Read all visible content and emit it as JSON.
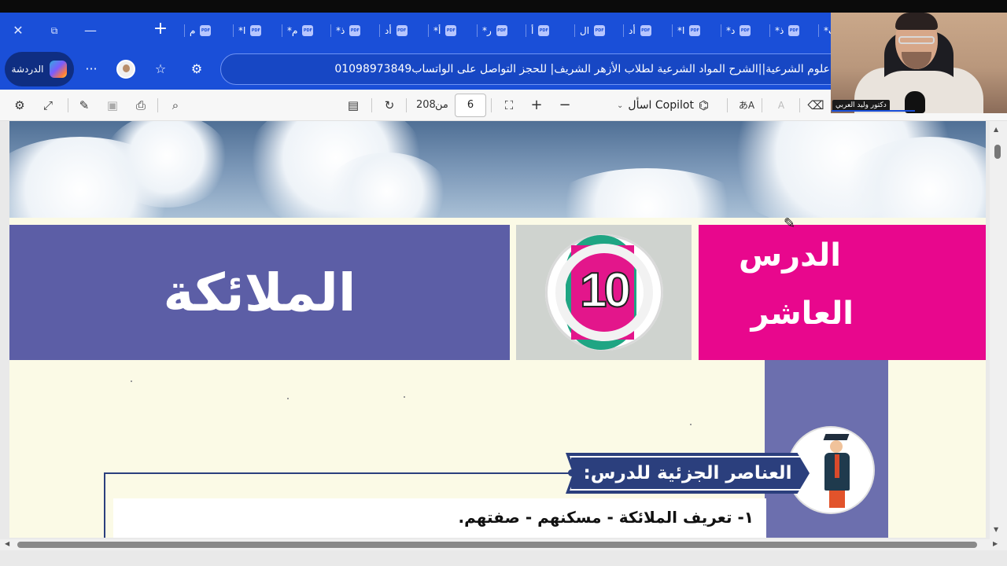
{
  "window": {
    "close": "✕",
    "restore": "⧉",
    "minimize": "—",
    "new_tab": "+"
  },
  "tabs": [
    {
      "label": "م"
    },
    {
      "label": "*ا"
    },
    {
      "label": "*م"
    },
    {
      "label": "*ذ"
    },
    {
      "label": "أد"
    },
    {
      "label": "*أ"
    },
    {
      "label": "*ر"
    },
    {
      "label": "أ"
    },
    {
      "label": "ال"
    },
    {
      "label": "أد"
    },
    {
      "label": "*ا"
    },
    {
      "label": "*د"
    },
    {
      "label": "*ذ"
    },
    {
      "label": "*ب"
    }
  ],
  "pdf_icon_text": "PDF",
  "nav": {
    "chat_label": "الدردشة",
    "more": "···",
    "favorite": "☆",
    "extensions": "⚙",
    "address": "علوم الشرعية||الشرح المواد الشرعية لطلاب الأزهر الشريف| للحجز التواصل على الواتساب01098973849"
  },
  "pdf_toolbar": {
    "page_current": "6",
    "page_of": "من",
    "page_total": "208",
    "ask_copilot": "اسأل Copilot",
    "translate": "あA"
  },
  "webcam": {
    "name": "دكتور وليد العربي"
  },
  "document": {
    "title": "الملائكة",
    "lesson_number": "10",
    "lesson_line1": "الدرس",
    "lesson_line2": "العاشر",
    "section_header": "العناصر الجزئية للدرس:",
    "item_1": "١- تعريف الملائكة - مسكنهم - صفتهم."
  },
  "colors": {
    "browser_blue": "#1a4fd8",
    "title_purple": "#5c5ea6",
    "lesson_pink": "#e8078d",
    "number_green": "#1fa583",
    "ribbon_navy": "#2b3f7d",
    "page_cream": "#fbfae6"
  }
}
